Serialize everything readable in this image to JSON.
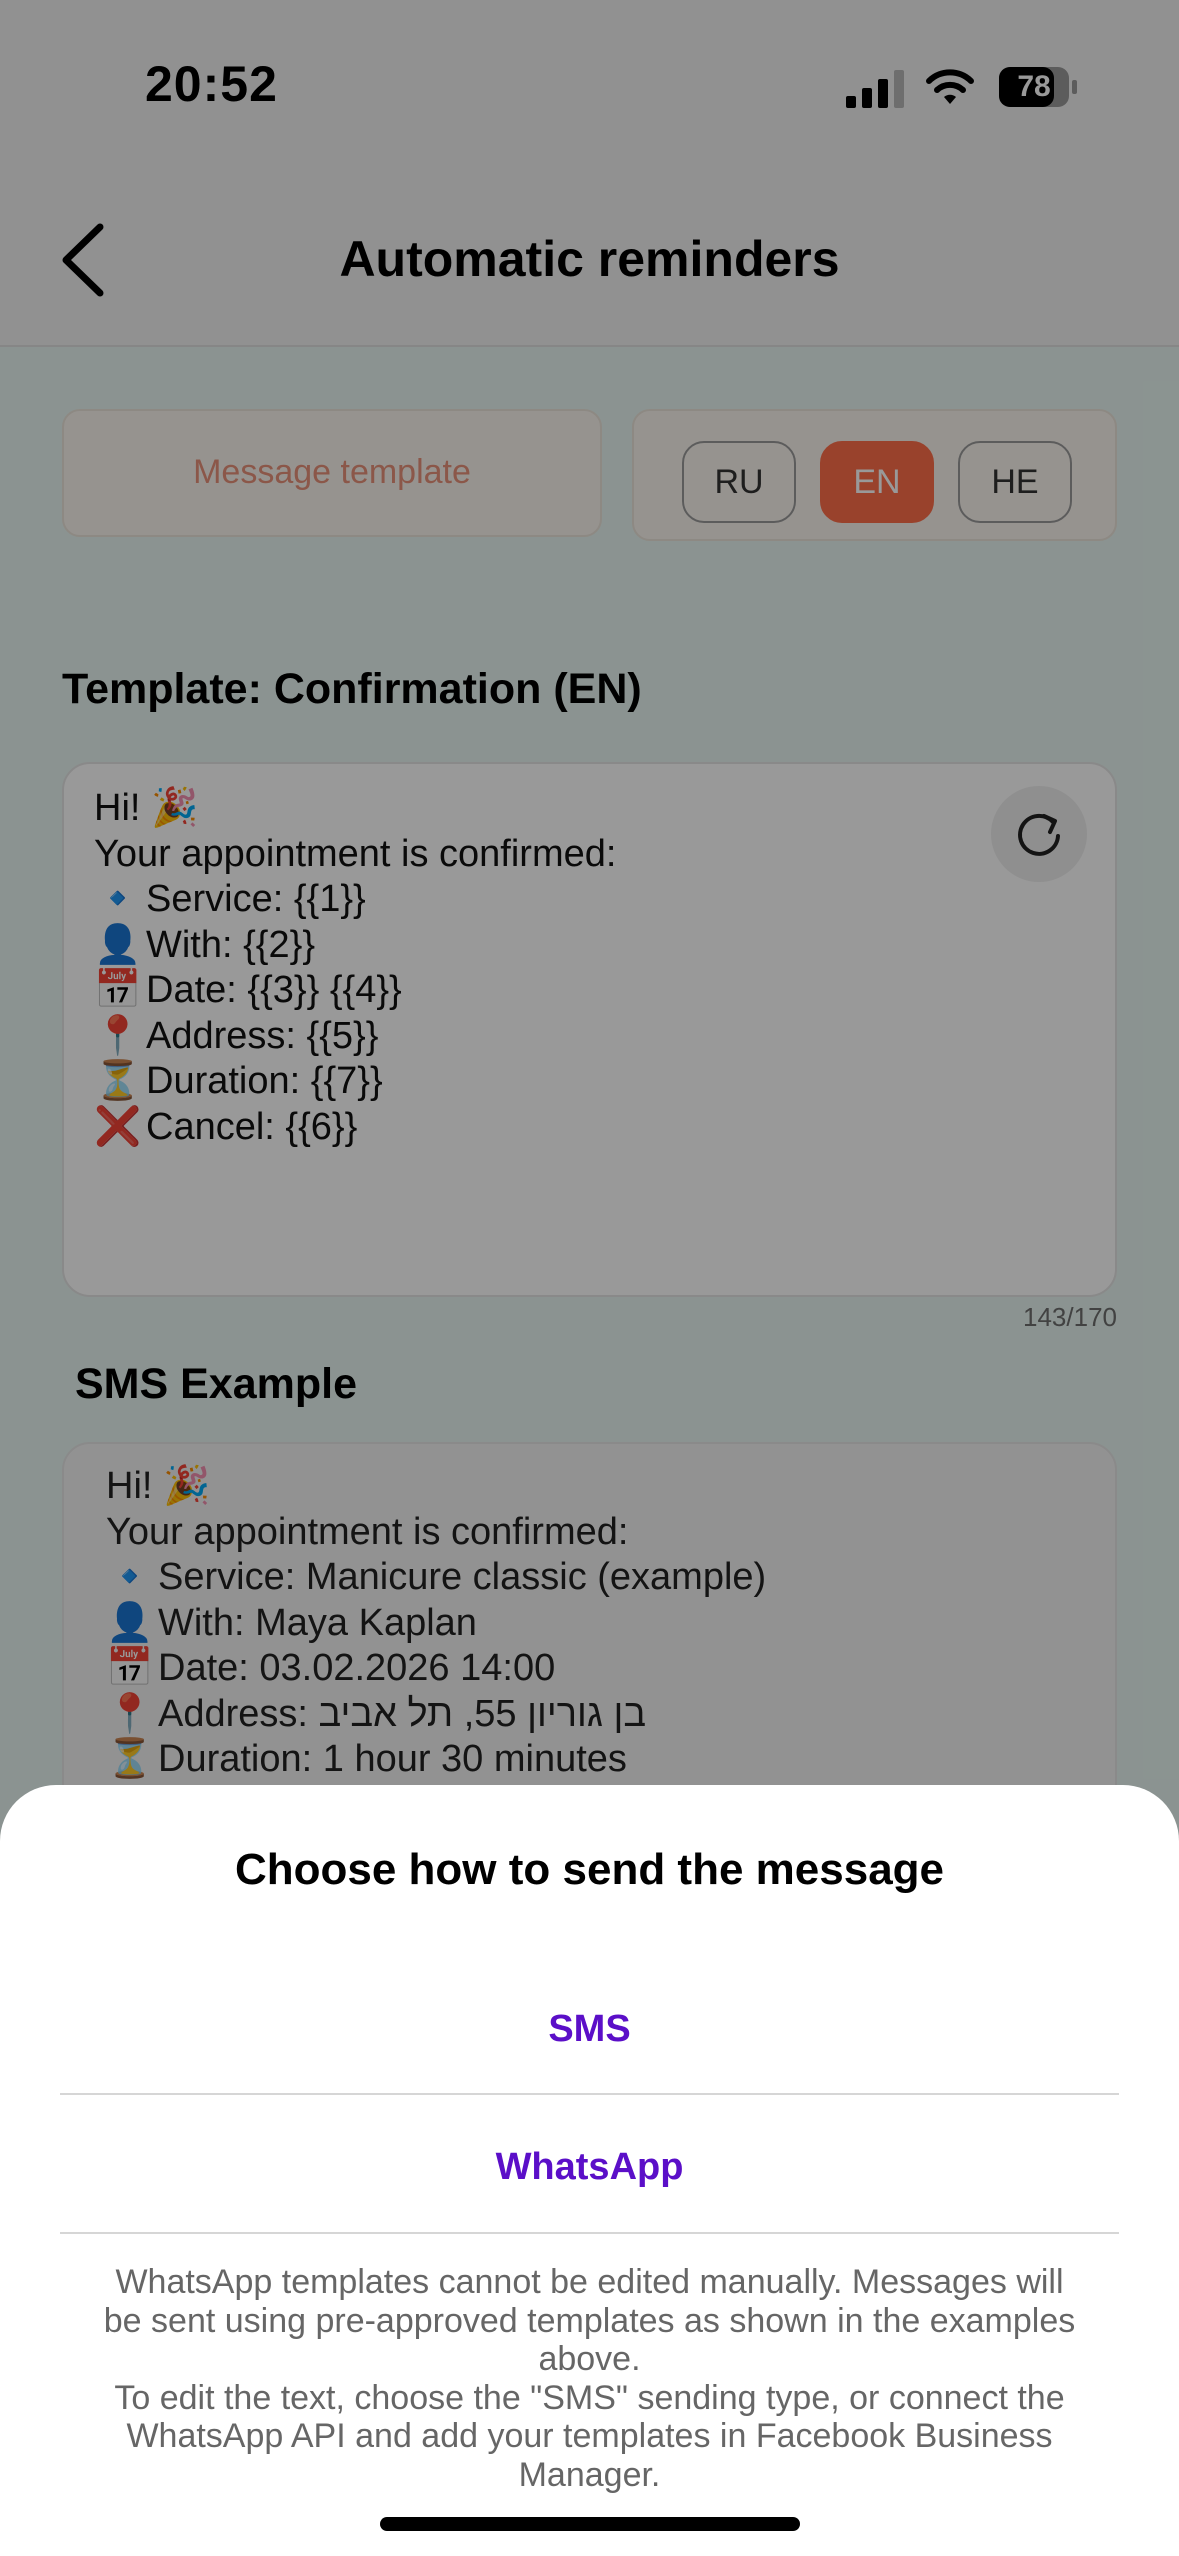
{
  "status_bar": {
    "time": "20:52",
    "battery": "78"
  },
  "header": {
    "title": "Automatic reminders"
  },
  "template_selector": {
    "label": "Message template"
  },
  "languages": [
    {
      "label": "RU",
      "active": false
    },
    {
      "label": "EN",
      "active": true
    },
    {
      "label": "HE",
      "active": false
    }
  ],
  "template": {
    "title": "Template: Confirmation (EN)",
    "lines": [
      {
        "emoji": "",
        "text": "Hi! 🎉"
      },
      {
        "emoji": "",
        "text": "Your appointment is confirmed:"
      },
      {
        "emoji": "🔹",
        "text": "Service: {{1}}"
      },
      {
        "emoji": "👤",
        "text": "With: {{2}}"
      },
      {
        "emoji": "📅",
        "text": "Date: {{3}} {{4}}"
      },
      {
        "emoji": "📍",
        "text": "Address: {{5}}"
      },
      {
        "emoji": "⏳",
        "text": "Duration: {{7}}"
      },
      {
        "emoji": "❌",
        "text": "Cancel: {{6}}"
      }
    ],
    "counter": "143/170"
  },
  "sms_example": {
    "title": "SMS Example",
    "lines": [
      {
        "emoji": "",
        "text": "Hi! 🎉"
      },
      {
        "emoji": "",
        "text": "Your appointment is confirmed:"
      },
      {
        "emoji": "🔹",
        "text": "Service: Manicure classic (example)"
      },
      {
        "emoji": "👤",
        "text": "With: Maya Kaplan"
      },
      {
        "emoji": "📅",
        "text": "Date: 03.02.2026 14:00"
      },
      {
        "emoji": "📍",
        "text": "Address: בן גוריון 55, תל אביב"
      },
      {
        "emoji": "⏳",
        "text": "Duration: 1 hour 30 minutes"
      }
    ]
  },
  "sheet": {
    "title": "Choose how to send the message",
    "options": [
      "SMS",
      "WhatsApp"
    ],
    "note_lines": [
      "WhatsApp templates cannot be edited manually. Messages will",
      "be sent using pre-approved templates as shown in the examples",
      "above.",
      "To edit the text, choose the \"SMS\" sending type, or connect the",
      "WhatsApp API and add your templates in Facebook Business",
      "Manager."
    ]
  },
  "colors": {
    "accent": "#ff6f4a",
    "option_text": "#5b0fc8",
    "content_bg": "#e8f6f2"
  }
}
